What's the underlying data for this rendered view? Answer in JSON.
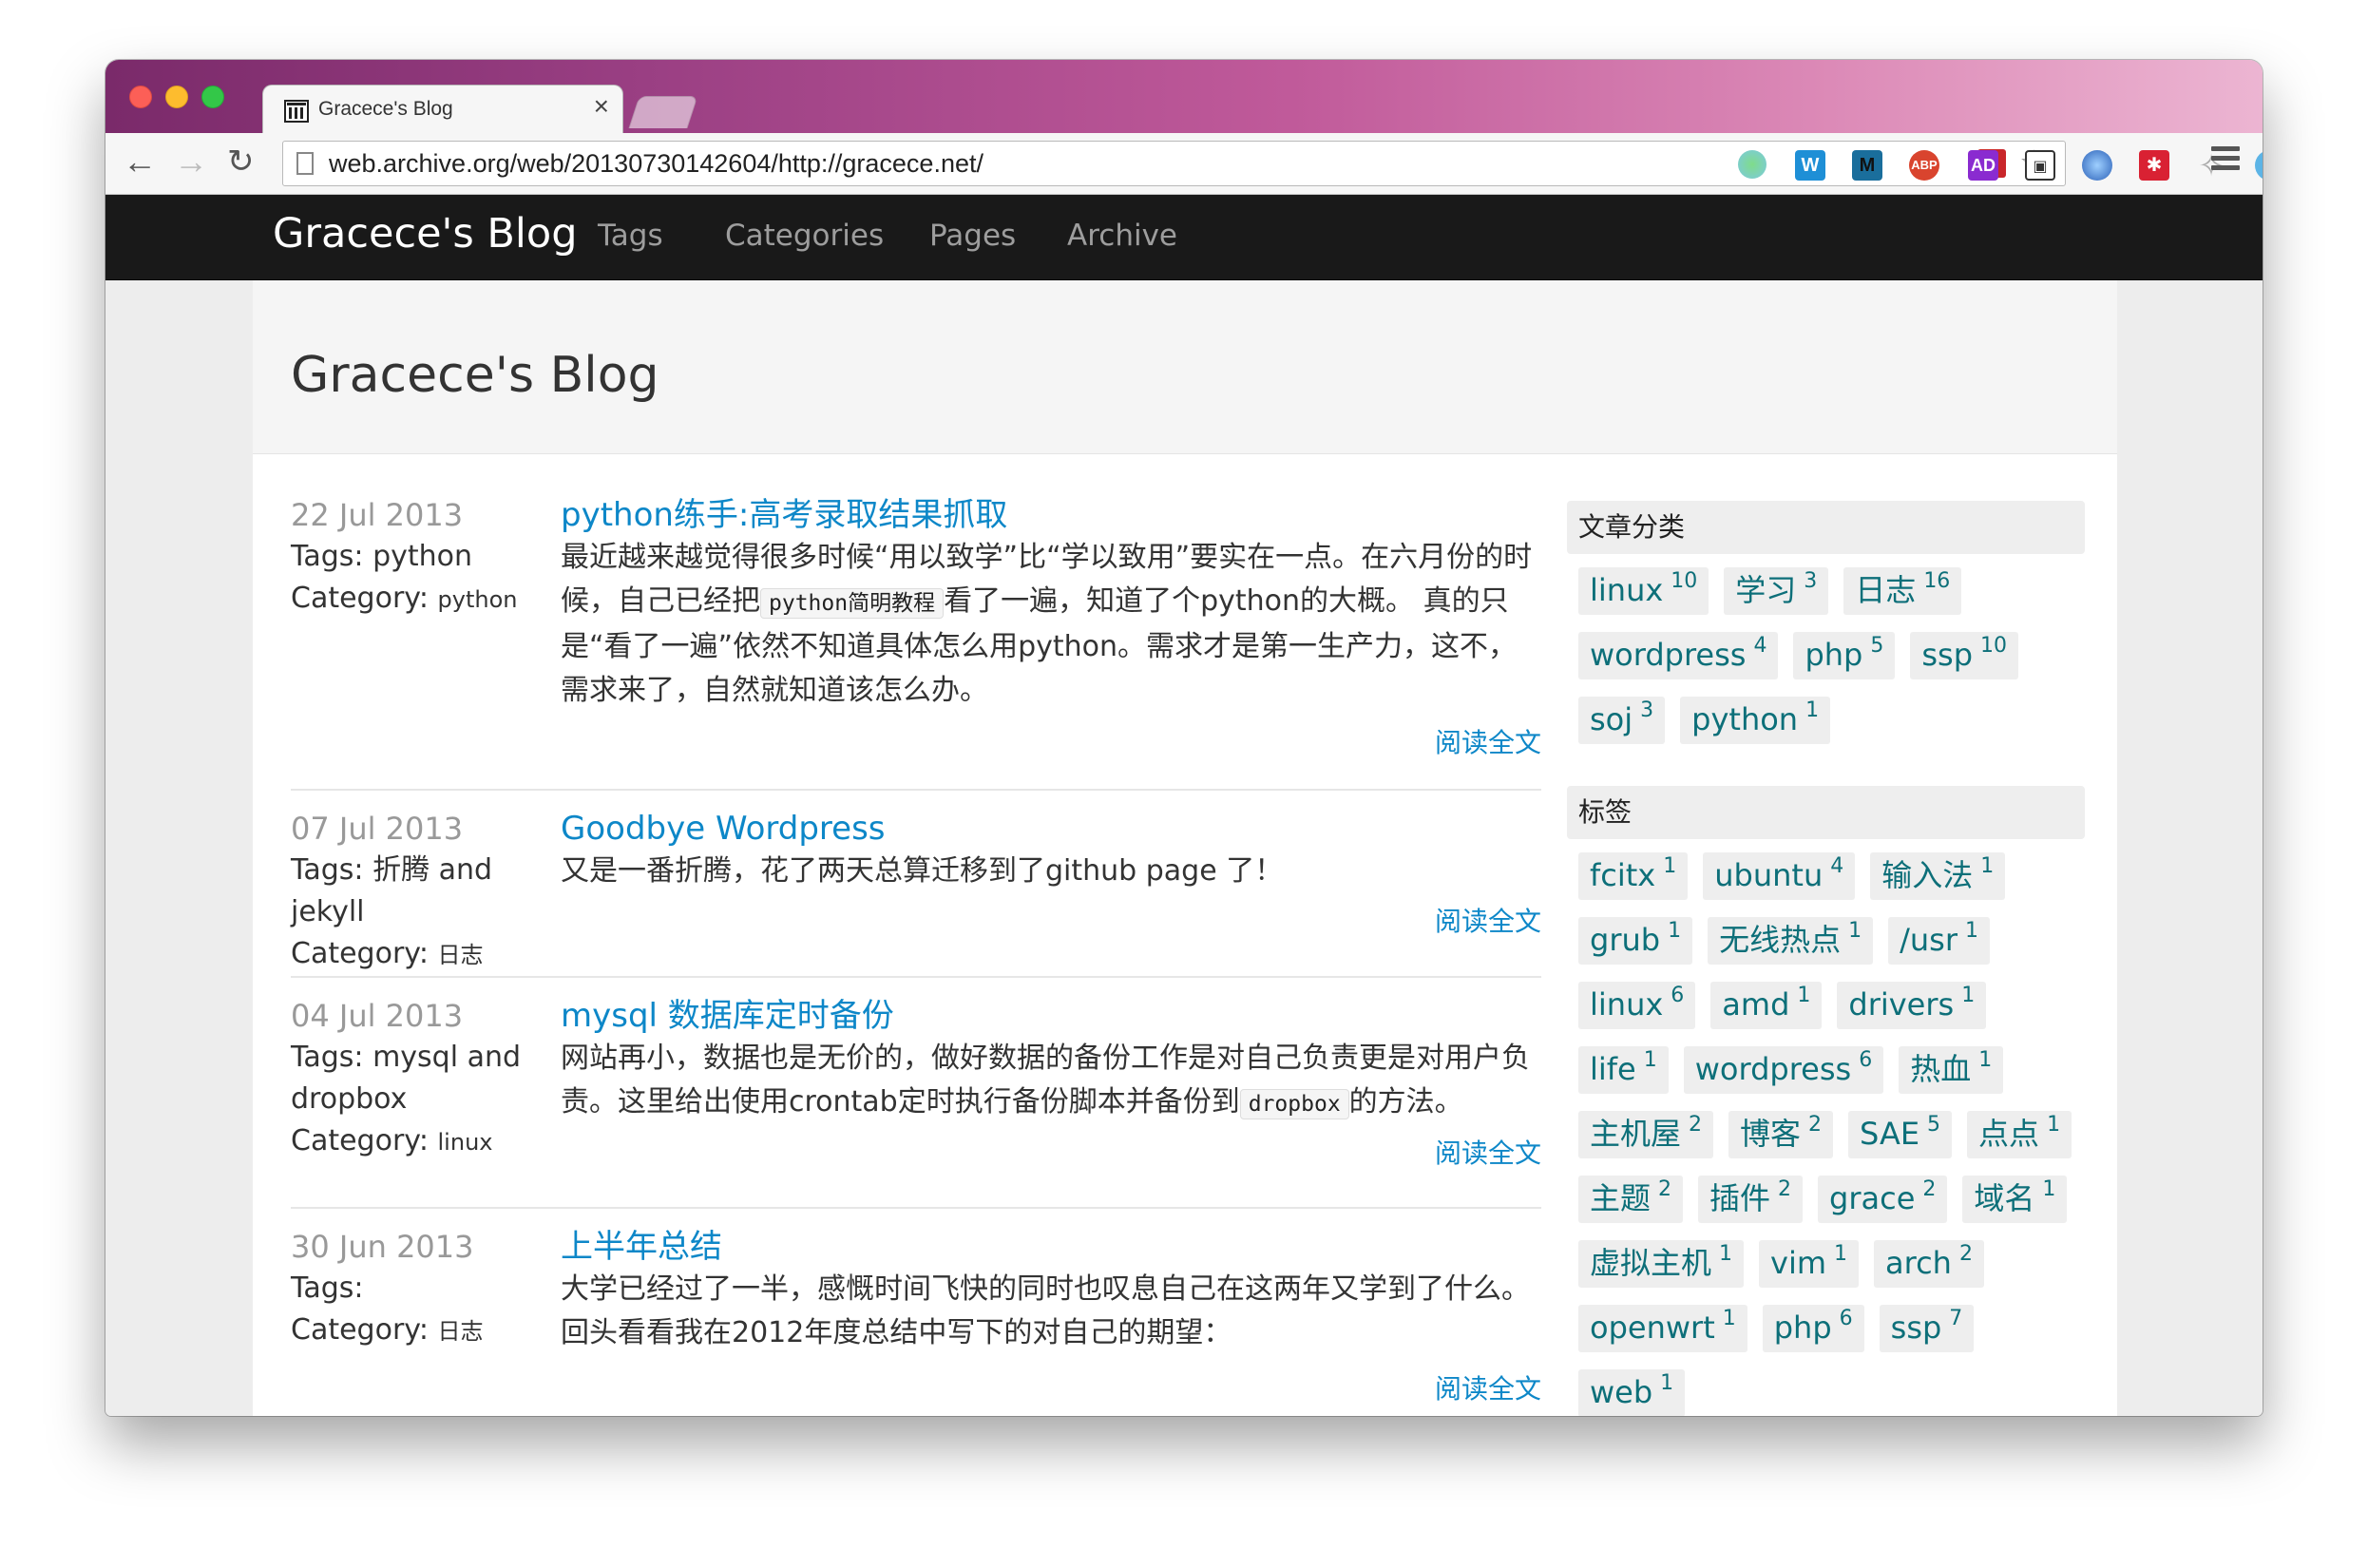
{
  "browser": {
    "tab_title": "Gracece's Blog",
    "tab_close": "×",
    "url": "web.archive.org/web/20130730142604/http://gracece.net/",
    "toolbar_icons": [
      "back-icon",
      "forward-icon",
      "reload-icon",
      "flash-icon",
      "bookmark-star-icon",
      "extension-green-dot-icon",
      "extension-w-icon",
      "extension-m-icon",
      "adblock-plus-icon",
      "adblock-ad-icon",
      "image-icon",
      "globe-icon",
      "snowflake-icon",
      "puzzle-icon",
      "v-icon",
      "menu-icon"
    ]
  },
  "site": {
    "brand": "Gracece's Blog",
    "nav": [
      "Tags",
      "Categories",
      "Pages",
      "Archive"
    ],
    "page_title": "Gracece's Blog"
  },
  "posts": [
    {
      "date": "22 Jul 2013",
      "tags_label": "Tags:",
      "tags": "python",
      "category_label": "Category:",
      "category": "python",
      "title": "python练手:高考录取结果抓取",
      "excerpt_before": "最近越来越觉得很多时候“用以致学”比“学以致用”要实在一点。在六月份的时候，自己已经把",
      "code": "python简明教程",
      "excerpt_after": "看了一遍，知道了个python的大概。 真的只是“看了一遍”依然不知道具体怎么用python。需求才是第一生产力，这不，需求来了，自然就知道该怎么办。",
      "read_more": "阅读全文"
    },
    {
      "date": "07 Jul 2013",
      "tags_label": "Tags:",
      "tags": "折腾 and jekyll",
      "category_label": "Category:",
      "category": "日志",
      "title": "Goodbye Wordpress",
      "excerpt": "又是一番折腾，花了两天总算迁移到了github page 了！",
      "read_more": "阅读全文"
    },
    {
      "date": "04 Jul 2013",
      "tags_label": "Tags:",
      "tags": "mysql and dropbox",
      "category_label": "Category:",
      "category": "linux",
      "title": "mysql 数据库定时备份",
      "excerpt_before": "网站再小，数据也是无价的，做好数据的备份工作是对自己负责更是对用户负责。这里给出使用crontab定时执行备份脚本并备份到",
      "code": "dropbox",
      "excerpt_after": "的方法。",
      "read_more": "阅读全文"
    },
    {
      "date": "30 Jun 2013",
      "tags_label": "Tags:",
      "tags": "",
      "category_label": "Category:",
      "category": "日志",
      "title": "上半年总结",
      "excerpt": "大学已经过了一半，感慨时间飞快的同时也叹息自己在这两年又学到了什么。回头看看我在2012年度总结中写下的对自己的期望：",
      "read_more": "阅读全文"
    }
  ],
  "sidebar": {
    "categories_heading": "文章分类",
    "categories": [
      {
        "name": "linux",
        "count": "10"
      },
      {
        "name": "学习",
        "count": "3"
      },
      {
        "name": "日志",
        "count": "16"
      },
      {
        "name": "wordpress",
        "count": "4"
      },
      {
        "name": "php",
        "count": "5"
      },
      {
        "name": "ssp",
        "count": "10"
      },
      {
        "name": "soj",
        "count": "3"
      },
      {
        "name": "python",
        "count": "1"
      }
    ],
    "tags_heading": "标签",
    "tags": [
      {
        "name": "fcitx",
        "count": "1"
      },
      {
        "name": "ubuntu",
        "count": "4"
      },
      {
        "name": "输入法",
        "count": "1"
      },
      {
        "name": "grub",
        "count": "1"
      },
      {
        "name": "无线热点",
        "count": "1"
      },
      {
        "name": "/usr",
        "count": "1"
      },
      {
        "name": "linux",
        "count": "6"
      },
      {
        "name": "amd",
        "count": "1"
      },
      {
        "name": "drivers",
        "count": "1"
      },
      {
        "name": "life",
        "count": "1"
      },
      {
        "name": "wordpress",
        "count": "6"
      },
      {
        "name": "热血",
        "count": "1"
      },
      {
        "name": "主机屋",
        "count": "2"
      },
      {
        "name": "博客",
        "count": "2"
      },
      {
        "name": "SAE",
        "count": "5"
      },
      {
        "name": "点点",
        "count": "1"
      },
      {
        "name": "主题",
        "count": "2"
      },
      {
        "name": "插件",
        "count": "2"
      },
      {
        "name": "grace",
        "count": "2"
      },
      {
        "name": "域名",
        "count": "1"
      },
      {
        "name": "虚拟主机",
        "count": "1"
      },
      {
        "name": "vim",
        "count": "1"
      },
      {
        "name": "arch",
        "count": "2"
      },
      {
        "name": "openwrt",
        "count": "1"
      },
      {
        "name": "php",
        "count": "6"
      },
      {
        "name": "ssp",
        "count": "7"
      },
      {
        "name": "web",
        "count": "1"
      }
    ]
  }
}
